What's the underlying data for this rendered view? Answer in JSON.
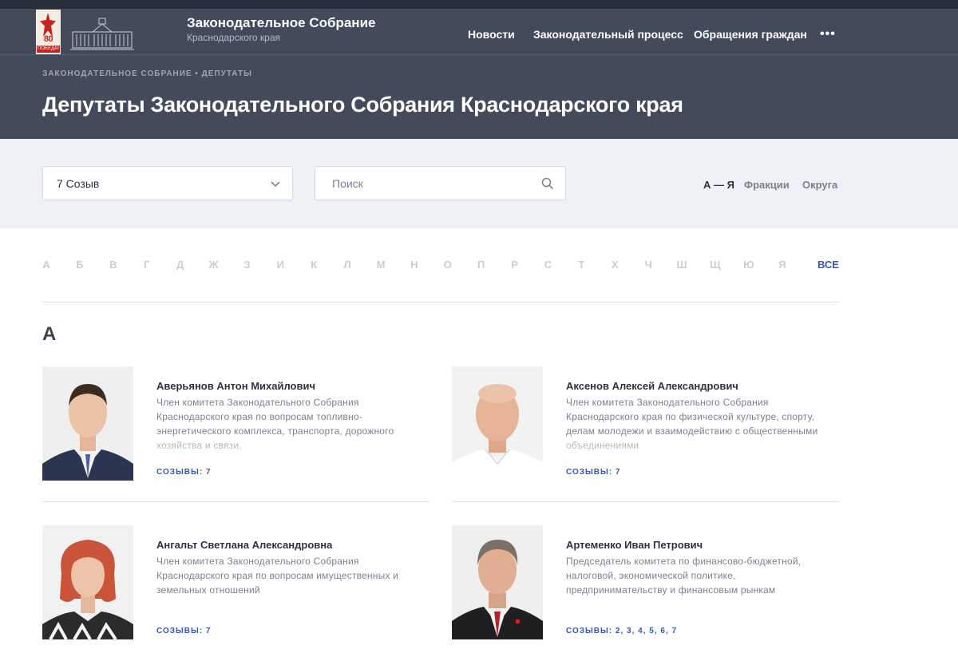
{
  "header": {
    "org_title": "Законодательное Собрание",
    "org_subtitle": "Краснодарского края",
    "logo_badge_text": "80",
    "logo_badge_caption": "ПОБЕДА!",
    "menu": [
      "Новости",
      "Законодательный процесс",
      "Обращения граждан"
    ],
    "more_label": "•••"
  },
  "breadcrumb": {
    "items": [
      "Законодательное Собрание",
      "Депутаты"
    ],
    "separator": "•"
  },
  "page_title": "Депутаты Законодательного Собрания Краснодарского края",
  "filters": {
    "convocation_value": "7 Созыв",
    "search_placeholder": "Поиск",
    "sort_options": [
      "А — Я",
      "Фракции",
      "Округа"
    ],
    "sort_active": "А — Я"
  },
  "alphabet": {
    "letters": [
      "А",
      "Б",
      "В",
      "Г",
      "Д",
      "Ж",
      "З",
      "И",
      "К",
      "Л",
      "М",
      "Н",
      "О",
      "П",
      "Р",
      "С",
      "Т",
      "Х",
      "Ч",
      "Ш",
      "Щ",
      "Ю",
      "Я"
    ],
    "all_label": "ВСЕ"
  },
  "section_letter": "А",
  "deputies": [
    {
      "name": "Аверьянов Антон Михайлович",
      "description": "Член комитета Законодательного Собрания Краснодарского края по вопросам топливно-энергетического комплекса, транспорта, дорожного хозяйства и связи.",
      "convocations": "СОЗЫВЫ: 7"
    },
    {
      "name": "Аксенов Алексей Александрович",
      "description": "Член комитета Законодательного Собрания Краснодарского края по физической культуре, спорту, делам молодежи и взаимодействию с общественными объединениями",
      "convocations": "СОЗЫВЫ: 7"
    },
    {
      "name": "Ангальт Светлана Александровна",
      "description": "Член комитета Законодательного Собрания Краснодарского края по вопросам имущественных и земельных отношений",
      "convocations": "СОЗЫВЫ: 7"
    },
    {
      "name": "Артеменко Иван Петрович",
      "description": "Председатель комитета по финансово-бюджетной, налоговой, экономической политике, предпринимательству и финансовым рынкам",
      "convocations": "СОЗЫВЫ: 2, 3, 4, 5, 6, 7"
    }
  ]
}
